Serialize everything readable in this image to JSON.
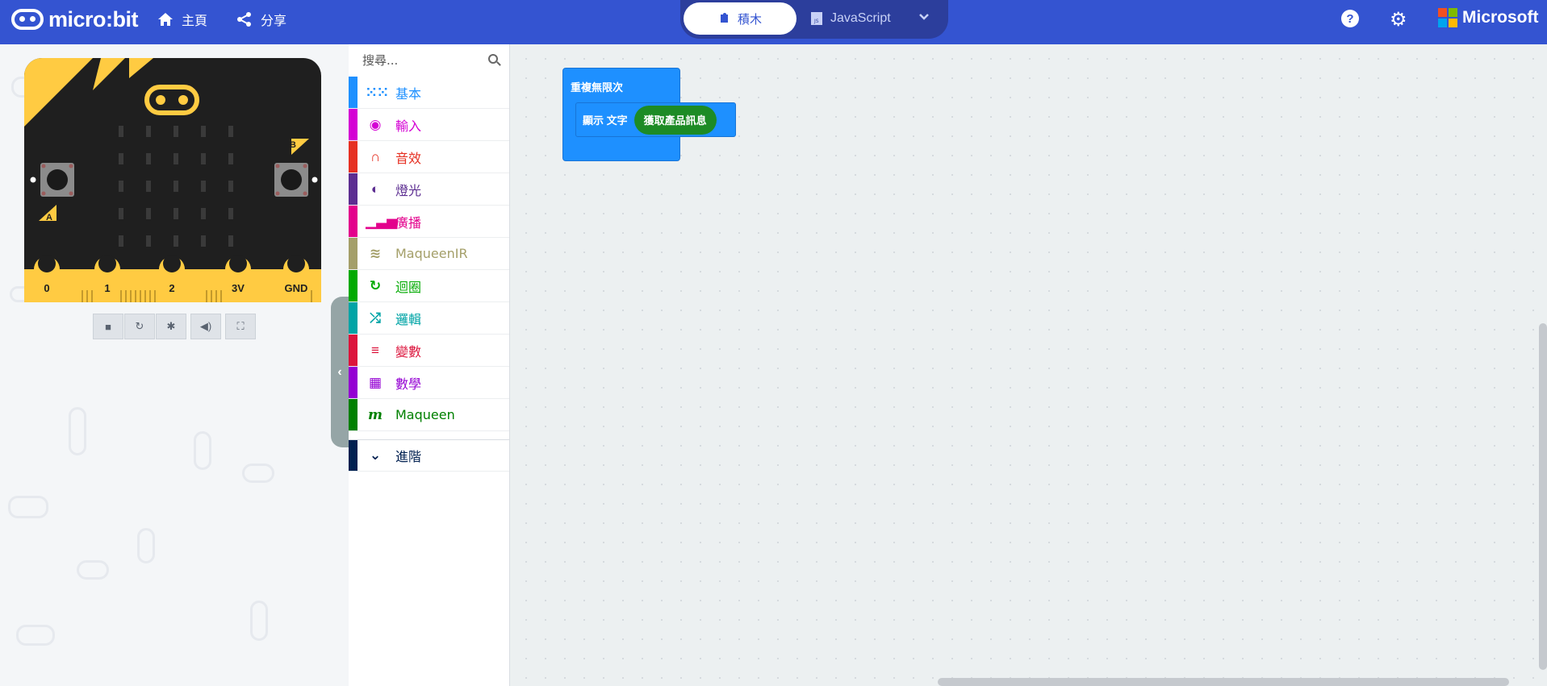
{
  "header": {
    "logo_text": "micro:bit",
    "home_label": "主頁",
    "share_label": "分享",
    "tab_blocks_label": "積木",
    "tab_js_label": "JavaScript",
    "brand_label": "Microsoft",
    "help_glyph": "?"
  },
  "simulator": {
    "pins": [
      "0",
      "1",
      "2",
      "3V",
      "GND"
    ],
    "button_a": "A",
    "button_b": "B"
  },
  "toolbox": {
    "search_placeholder": "搜尋...",
    "categories": [
      {
        "label": "基本",
        "color": "#1e90ff",
        "icon": "grid-icon"
      },
      {
        "label": "輸入",
        "color": "#d400d4",
        "icon": "target-icon"
      },
      {
        "label": "音效",
        "color": "#e63022",
        "icon": "headphones-icon"
      },
      {
        "label": "燈光",
        "color": "#5c2d91",
        "icon": "toggle-icon"
      },
      {
        "label": "廣播",
        "color": "#e3008c",
        "icon": "signal-bars-icon"
      },
      {
        "label": "MaqueenIR",
        "color": "#a49f69",
        "icon": "wifi-icon"
      },
      {
        "label": "迴圈",
        "color": "#00aa00",
        "icon": "refresh-icon"
      },
      {
        "label": "邏輯",
        "color": "#00a4a6",
        "icon": "shuffle-icon"
      },
      {
        "label": "變數",
        "color": "#dc143c",
        "icon": "list-icon"
      },
      {
        "label": "數學",
        "color": "#9400d3",
        "icon": "calculator-icon"
      },
      {
        "label": "Maqueen",
        "color": "#008000",
        "icon": "maqueen-m-icon"
      }
    ],
    "advanced_label": "進階",
    "advanced_color": "#002050"
  },
  "workspace": {
    "forever_label": "重複無限次",
    "show_label": "顯示 文字",
    "reporter_label": "獲取產品訊息"
  }
}
